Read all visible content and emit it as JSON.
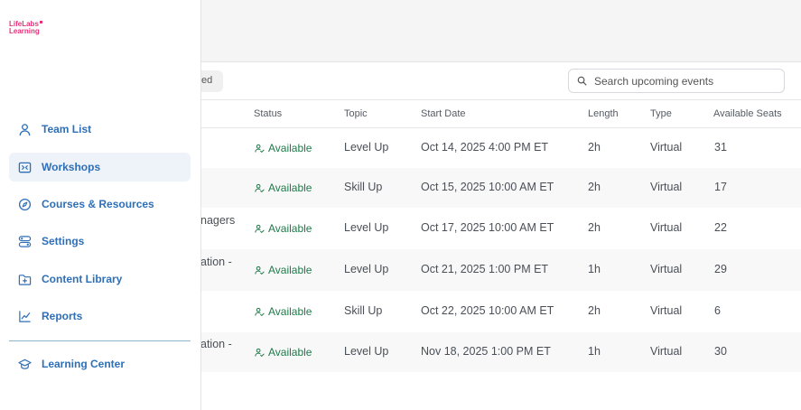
{
  "brand": {
    "logo_line1": "LifeLabs",
    "logo_line2": "Learning"
  },
  "sidebar": {
    "items": [
      {
        "label": "Team List",
        "icon": "user-icon",
        "active": false
      },
      {
        "label": "Workshops",
        "icon": "workshop-icon",
        "active": true
      },
      {
        "label": "Courses & Resources",
        "icon": "compass-icon",
        "active": false
      },
      {
        "label": "Settings",
        "icon": "settings-icon",
        "active": false
      },
      {
        "label": "Content Library",
        "icon": "folder-plus-icon",
        "active": false
      },
      {
        "label": "Reports",
        "icon": "chart-line-icon",
        "active": false
      }
    ],
    "footer_item": {
      "label": "Learning Center",
      "icon": "graduation-cap-icon"
    }
  },
  "toolbar": {
    "filter_chip_label": "ed",
    "search": {
      "placeholder": "Search upcoming events",
      "value": ""
    }
  },
  "table": {
    "columns": [
      "Status",
      "Topic",
      "Start Date",
      "Length",
      "Type",
      "Available Seats"
    ],
    "rows": [
      {
        "name": "",
        "status": "Available",
        "topic": "Level Up",
        "start": "Oct 14, 2025 4:00 PM ET",
        "length": "2h",
        "type": "Virtual",
        "seats": "31"
      },
      {
        "name": "",
        "status": "Available",
        "topic": "Skill Up",
        "start": "Oct 15, 2025 10:00 AM ET",
        "length": "2h",
        "type": "Virtual",
        "seats": "17"
      },
      {
        "name": "nagers",
        "status": "Available",
        "topic": "Level Up",
        "start": "Oct 17, 2025 10:00 AM ET",
        "length": "2h",
        "type": "Virtual",
        "seats": "22"
      },
      {
        "name": "ation -",
        "status": "Available",
        "topic": "Level Up",
        "start": "Oct 21, 2025 1:00 PM ET",
        "length": "1h",
        "type": "Virtual",
        "seats": "29"
      },
      {
        "name": "",
        "status": "Available",
        "topic": "Skill Up",
        "start": "Oct 22, 2025 10:00 AM ET",
        "length": "2h",
        "type": "Virtual",
        "seats": "6"
      },
      {
        "name": "ation -",
        "status": "Available",
        "topic": "Level Up",
        "start": "Nov 18, 2025 1:00 PM ET",
        "length": "1h",
        "type": "Virtual",
        "seats": "30"
      }
    ]
  },
  "colors": {
    "accent": "#2e6fb8",
    "status_available": "#1f7a4a",
    "brand_pink": "#e5337a",
    "active_nav_bg": "#eef2f9"
  }
}
